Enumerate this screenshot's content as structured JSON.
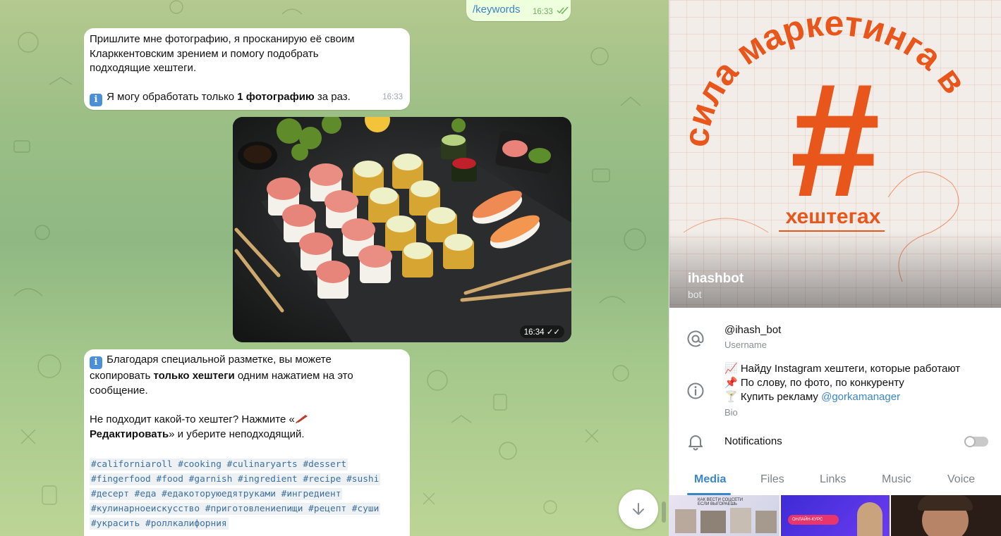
{
  "chat": {
    "outgoing": {
      "text": "/keywords",
      "time": "16:33"
    },
    "msg1": {
      "line1": "Пришлите мне фотографию, я просканирую её своим",
      "line2": "Кларккентовским зрением и помогу подобрать",
      "line3": "подходящие хештеги.",
      "note_pre": "Я могу обработать только ",
      "note_bold": "1 фотографию",
      "note_post": " за раз.",
      "time": "16:33"
    },
    "photo": {
      "time": "16:34",
      "alt": "sushi rolls photo"
    },
    "msg2": {
      "line1": "Благодаря специальной разметке, вы можете",
      "line2_pre": "скопировать ",
      "line2_bold": "только хештеги",
      "line2_post": " одним нажатием на это",
      "line3": "сообщение.",
      "line4": "Не подходит какой-то хештег? Нажмите «",
      "line5_bold": "Редактировать",
      "line5_post": "» и уберите неподходящий.",
      "tags": [
        "#californiaroll #cooking #culinaryarts #dessert ",
        "#fingerfood #food #garnish #ingredient #recipe #sushi ",
        "#десерт #еда #едакоторуюедятруками #ингредиент ",
        "#кулинарноеискусство #приготовлениепищи #рецепт #суши ",
        "#украсить #роллкалифорния"
      ]
    }
  },
  "profile": {
    "cover": {
      "arc_text": "сила маркетинга в",
      "hash": "#",
      "sub_text": "хештегах",
      "name": "ihashbot",
      "type": "bot"
    },
    "username": {
      "value": "@ihash_bot",
      "label": "Username"
    },
    "bio": {
      "line1": "📈 Найду Instagram хештеги, которые работают",
      "line2": "📌 По слову, по фото, по конкуренту",
      "line3_pre": "🍸 Купить рекламу ",
      "line3_link": "@gorkamanager",
      "label": "Bio"
    },
    "notifications": {
      "label": "Notifications",
      "enabled": false
    },
    "tabs": [
      "Media",
      "Files",
      "Links",
      "Music",
      "Voice"
    ],
    "active_tab": "Media",
    "thumbs": [
      {
        "caption": "КАК ВЕСТИ СОЦСЕТИ ЕСЛИ ВЫГОРАЕШЬ"
      },
      {
        "caption": "ОНЛАЙН-КУРС"
      },
      {
        "caption": ""
      }
    ]
  },
  "colors": {
    "accent": "#3a86c9",
    "brand_orange": "#e8561b",
    "outgoing_bg": "#eeffde"
  }
}
